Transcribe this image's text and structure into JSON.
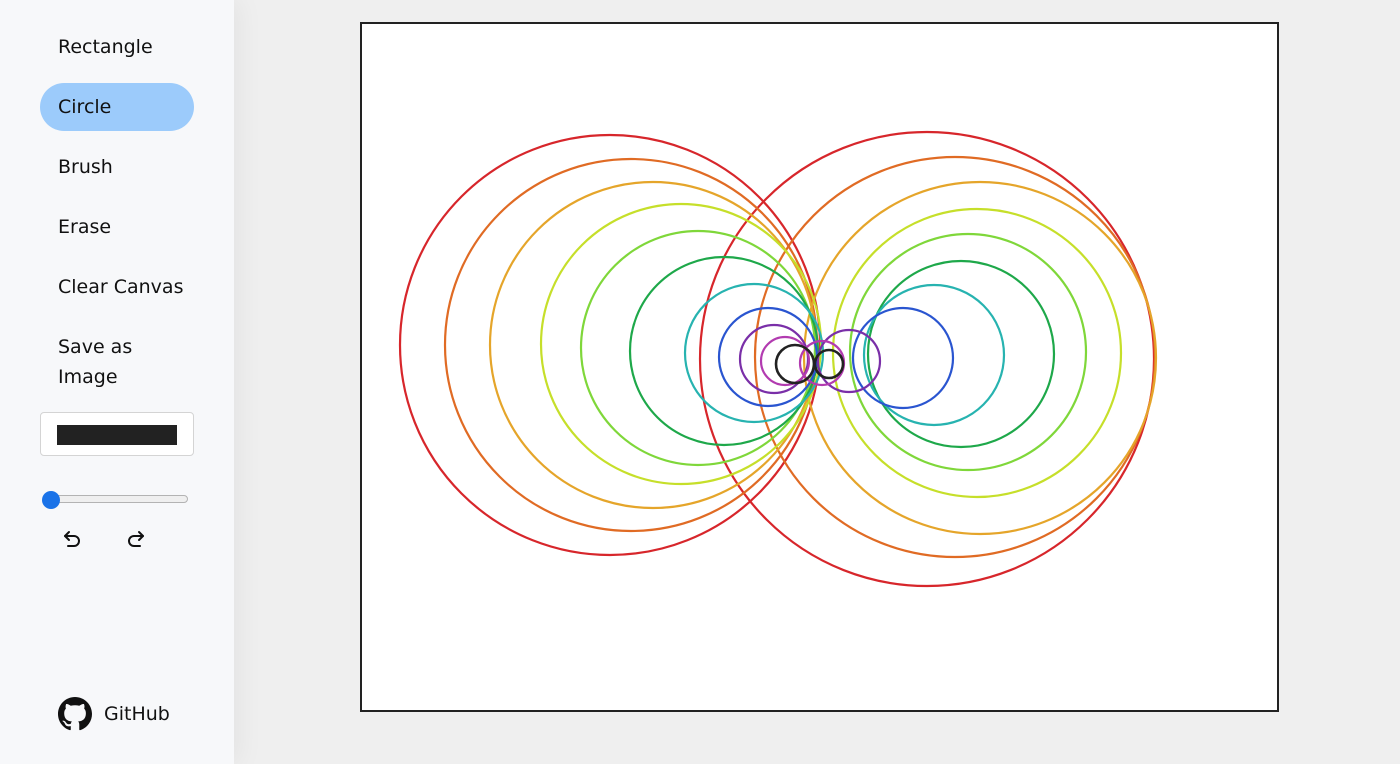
{
  "sidebar": {
    "tools": {
      "rectangle": "Rectangle",
      "circle": "Circle",
      "brush": "Brush",
      "erase": "Erase",
      "clear": "Clear Canvas",
      "save": "Save as Image"
    },
    "active_tool": "Circle",
    "color": "#222222",
    "undo_icon": "undo-arrow",
    "redo_icon": "redo-arrow",
    "github_label": "GitHub",
    "github_icon": "github-logo"
  },
  "colors": {
    "active_tool_bg": "#9ccbfb",
    "slider_accent": "#1a73e8"
  },
  "canvas": {
    "strokes": [
      {
        "color": "#d7262b"
      },
      {
        "color": "#e06b24"
      },
      {
        "color": "#e5a52a"
      },
      {
        "color": "#c6df2a"
      },
      {
        "color": "#7fd73a"
      },
      {
        "color": "#1ea84a"
      },
      {
        "color": "#27b3b0"
      },
      {
        "color": "#2a55d0"
      },
      {
        "color": "#7a2fa8"
      },
      {
        "color": "#b23bb0"
      },
      {
        "color": "#222222"
      }
    ]
  }
}
